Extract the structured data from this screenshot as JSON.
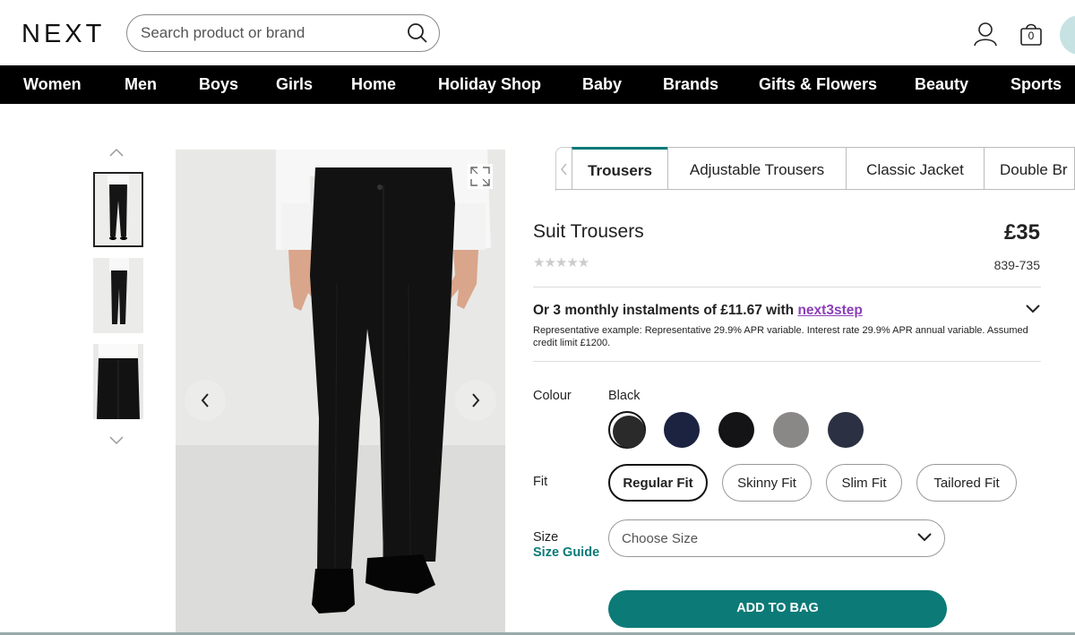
{
  "header": {
    "logo": "NEXT",
    "search_placeholder": "Search product or brand",
    "bag_count": "0"
  },
  "nav": {
    "items": [
      "Women",
      "Men",
      "Boys",
      "Girls",
      "Home",
      "Holiday Shop",
      "Baby",
      "Brands",
      "Gifts & Flowers",
      "Beauty",
      "Sports"
    ]
  },
  "tabs": {
    "items": [
      "Trousers",
      "Adjustable Trousers",
      "Classic Jacket",
      "Double Br"
    ],
    "active": "Trousers"
  },
  "product": {
    "title": "Suit Trousers",
    "price": "£35",
    "rating_stars": "★★★★★",
    "code": "839-735",
    "instalment_prefix": "Or 3 monthly instalments of £11.67 with ",
    "instalment_link": "next3step",
    "representative": "Representative example: Representative 29.9% APR variable. Interest rate 29.9% APR annual variable. Assumed credit limit £1200."
  },
  "options": {
    "colour_label": "Colour",
    "colour_selected": "Black",
    "swatches": [
      "#2a2a2a",
      "#1b2340",
      "#141416",
      "#8a8787",
      "#2b3042"
    ],
    "fit_label": "Fit",
    "fits": [
      "Regular Fit",
      "Skinny Fit",
      "Slim Fit",
      "Tailored Fit"
    ],
    "fit_selected": "Regular Fit",
    "size_label": "Size",
    "size_guide": "Size Guide",
    "size_placeholder": "Choose Size"
  },
  "cta": {
    "add_to_bag": "ADD TO BAG"
  },
  "colors": {
    "accent": "#0c7a77",
    "link_purple": "#8b3fb8"
  }
}
